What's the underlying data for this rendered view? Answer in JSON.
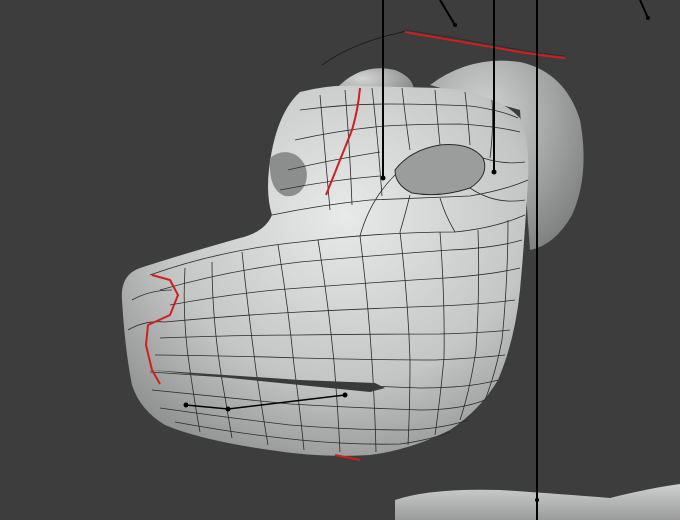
{
  "viewport": {
    "background": "#3d3d3d",
    "mesh_fill": "#c9cbcb",
    "mesh_shadow": "#8f9191",
    "wire_color": "#2a2a2a",
    "seam_color": "#d21e1e",
    "rig_line_color": "#000000",
    "icons": [
      "mesh-object-icon",
      "uv-seam-icon",
      "armature-bone-icon"
    ]
  }
}
